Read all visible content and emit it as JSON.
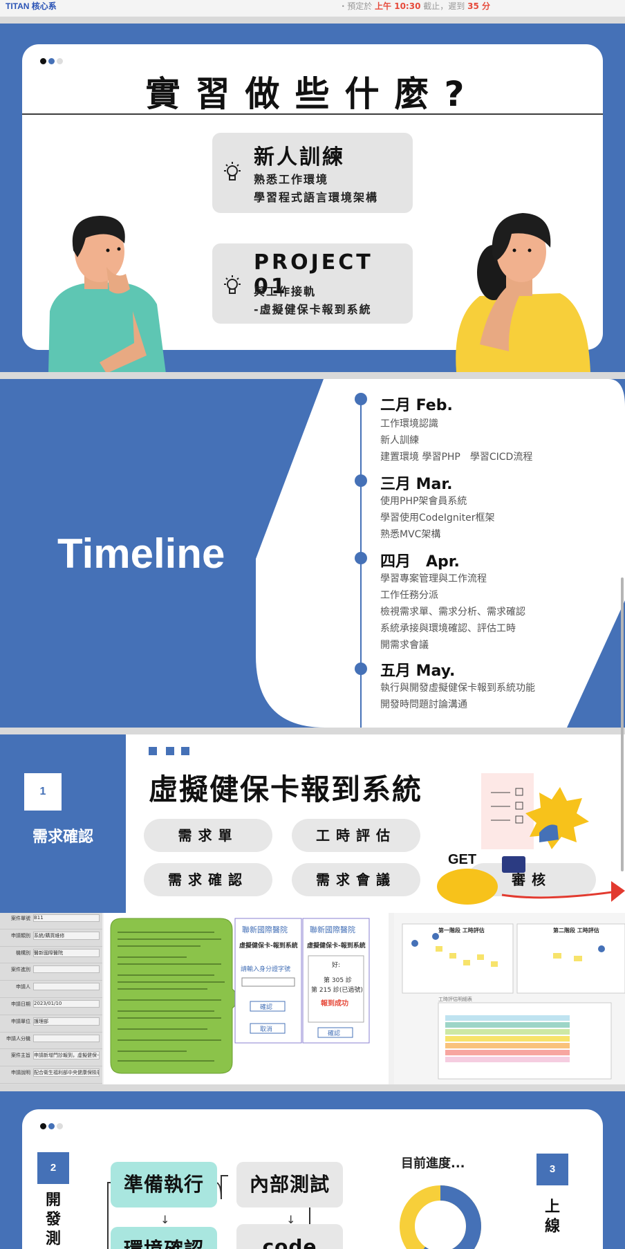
{
  "top_strip": {
    "logo_text": "TITAN 核心系",
    "due_prefix": "・預定於",
    "due_time": "上午 10:30",
    "due_middle": "截止，遲到",
    "due_late": "35 分"
  },
  "slide1": {
    "title": "實習做些什麼?",
    "box1": {
      "title": "新人訓練",
      "lines": [
        "熟悉工作環境",
        "學習程式語言環境架構"
      ]
    },
    "box2": {
      "title": "PROJECT 01",
      "lines": [
        "與工作接軌",
        "-虛擬健保卡報到系統"
      ]
    }
  },
  "slide2": {
    "title": "Timeline",
    "months": [
      {
        "label": "二月 Feb.",
        "items": [
          "工作環境認識",
          "新人訓練",
          "建置環境 學習PHP　學習CICD流程"
        ]
      },
      {
        "label": "三月 Mar.",
        "items": [
          "使用PHP架會員系統",
          "學習使用CodeIgniter框架",
          "熟悉MVC架構"
        ]
      },
      {
        "label": "四月　Apr.",
        "items": [
          "學習專案管理與工作流程",
          "工作任務分派",
          "檢視需求單、需求分析、需求確認",
          "系統承接與環境確認、評估工時",
          "開需求會議"
        ]
      },
      {
        "label": "五月 May.",
        "items": [
          "執行與開發虛擬健保卡報到系統功能",
          "開發時問題討論溝通"
        ]
      }
    ]
  },
  "slide3": {
    "step_number": "1",
    "step_label": "需求確認",
    "title": "虛擬健保卡報到系統",
    "pills": [
      "需求單",
      "工時評估",
      "需求確認",
      "需求會議",
      "審核"
    ],
    "get_label": "GET",
    "form": {
      "labels": [
        "案件單號",
        "申請類別",
        "機構別",
        "案件進別",
        "申請人",
        "申請日期",
        "申請單位",
        "申請人分機",
        "案件主旨",
        "申請說明"
      ],
      "values": [
        "B11",
        "系統/購買維修",
        "醫新國際醫院",
        "",
        "",
        "2023/01/10",
        "護理部",
        "",
        "申請新增門診報到，虛擬健保卡",
        "配合衛生福利部中央健康保險署作業"
      ]
    },
    "phone1": {
      "hospital": "聯新國際醫院",
      "title": "虛擬健保卡-報到系統",
      "prompt": "請輸入身分證字號",
      "confirm": "確認",
      "cancel": "取消"
    },
    "phone2": {
      "hospital": "聯新國際醫院",
      "title": "虛擬健保卡-報到系統",
      "line1": "好:",
      "line2": "第 305 診",
      "line3": "第 215 診(已過號)",
      "success": "報到成功",
      "confirm": "確認"
    },
    "eval_titles": [
      "第一階段 工時評估",
      "第二階段 工時評估"
    ],
    "eval_caption": "工時評估明細表"
  },
  "slide4": {
    "step2_number": "2",
    "step2_label": "開發測",
    "step3_number": "3",
    "step3_label": "上線",
    "flow_left": [
      "準備執行",
      "環境確認"
    ],
    "flow_right": [
      "內部測試",
      "code"
    ],
    "progress_label": "目前進度...",
    "progress_fraction": 0.6
  },
  "colors": {
    "brand_blue": "#4571b7",
    "teal": "#a9e6df",
    "green_doc": "#8bc34a",
    "alert_red": "#e64a3b"
  }
}
